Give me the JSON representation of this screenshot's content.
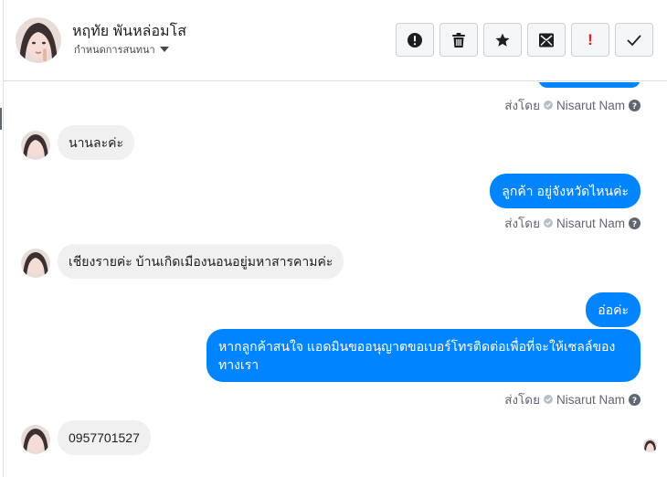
{
  "header": {
    "contact_name": "หฤทัย พันหล่อมโส",
    "assign_label": "กำหนดการสนทนา"
  },
  "toolbar": {
    "buttons": [
      {
        "name": "spam-button",
        "icon": "alert-circle-icon"
      },
      {
        "name": "delete-button",
        "icon": "trash-icon"
      },
      {
        "name": "star-button",
        "icon": "star-icon"
      },
      {
        "name": "mark-unread-button",
        "icon": "envelope-icon"
      },
      {
        "name": "priority-button",
        "icon": "exclamation-icon",
        "glyph": "!"
      },
      {
        "name": "done-button",
        "icon": "check-icon"
      }
    ]
  },
  "thread": {
    "sent_by_prefix": "ส่งโดย",
    "sender_name": "Nisarut Nam",
    "messages": [
      {
        "direction": "incoming",
        "text": "นานละค่ะ"
      },
      {
        "direction": "outgoing",
        "text": "ลูกค้า อยู่จังหวัดไหนค่ะ"
      },
      {
        "direction": "incoming",
        "text": "เชียงรายค่ะ บ้านเกิดเมืองนอนอยู่มหาสารคามค่ะ"
      },
      {
        "direction": "outgoing",
        "text": "อ่อค่ะ"
      },
      {
        "direction": "outgoing",
        "text": "หากลูกค้าสนใจ แอดมินขออนุญาตขอเบอร์โทรติดต่อเพื่อที่จะให้เซลล์ของทางเรา"
      },
      {
        "direction": "incoming",
        "text": "0957701527"
      }
    ]
  },
  "colors": {
    "outgoing_bubble": "#0084ff",
    "incoming_bubble": "#f0f0f0",
    "priority_red": "#e02020"
  }
}
